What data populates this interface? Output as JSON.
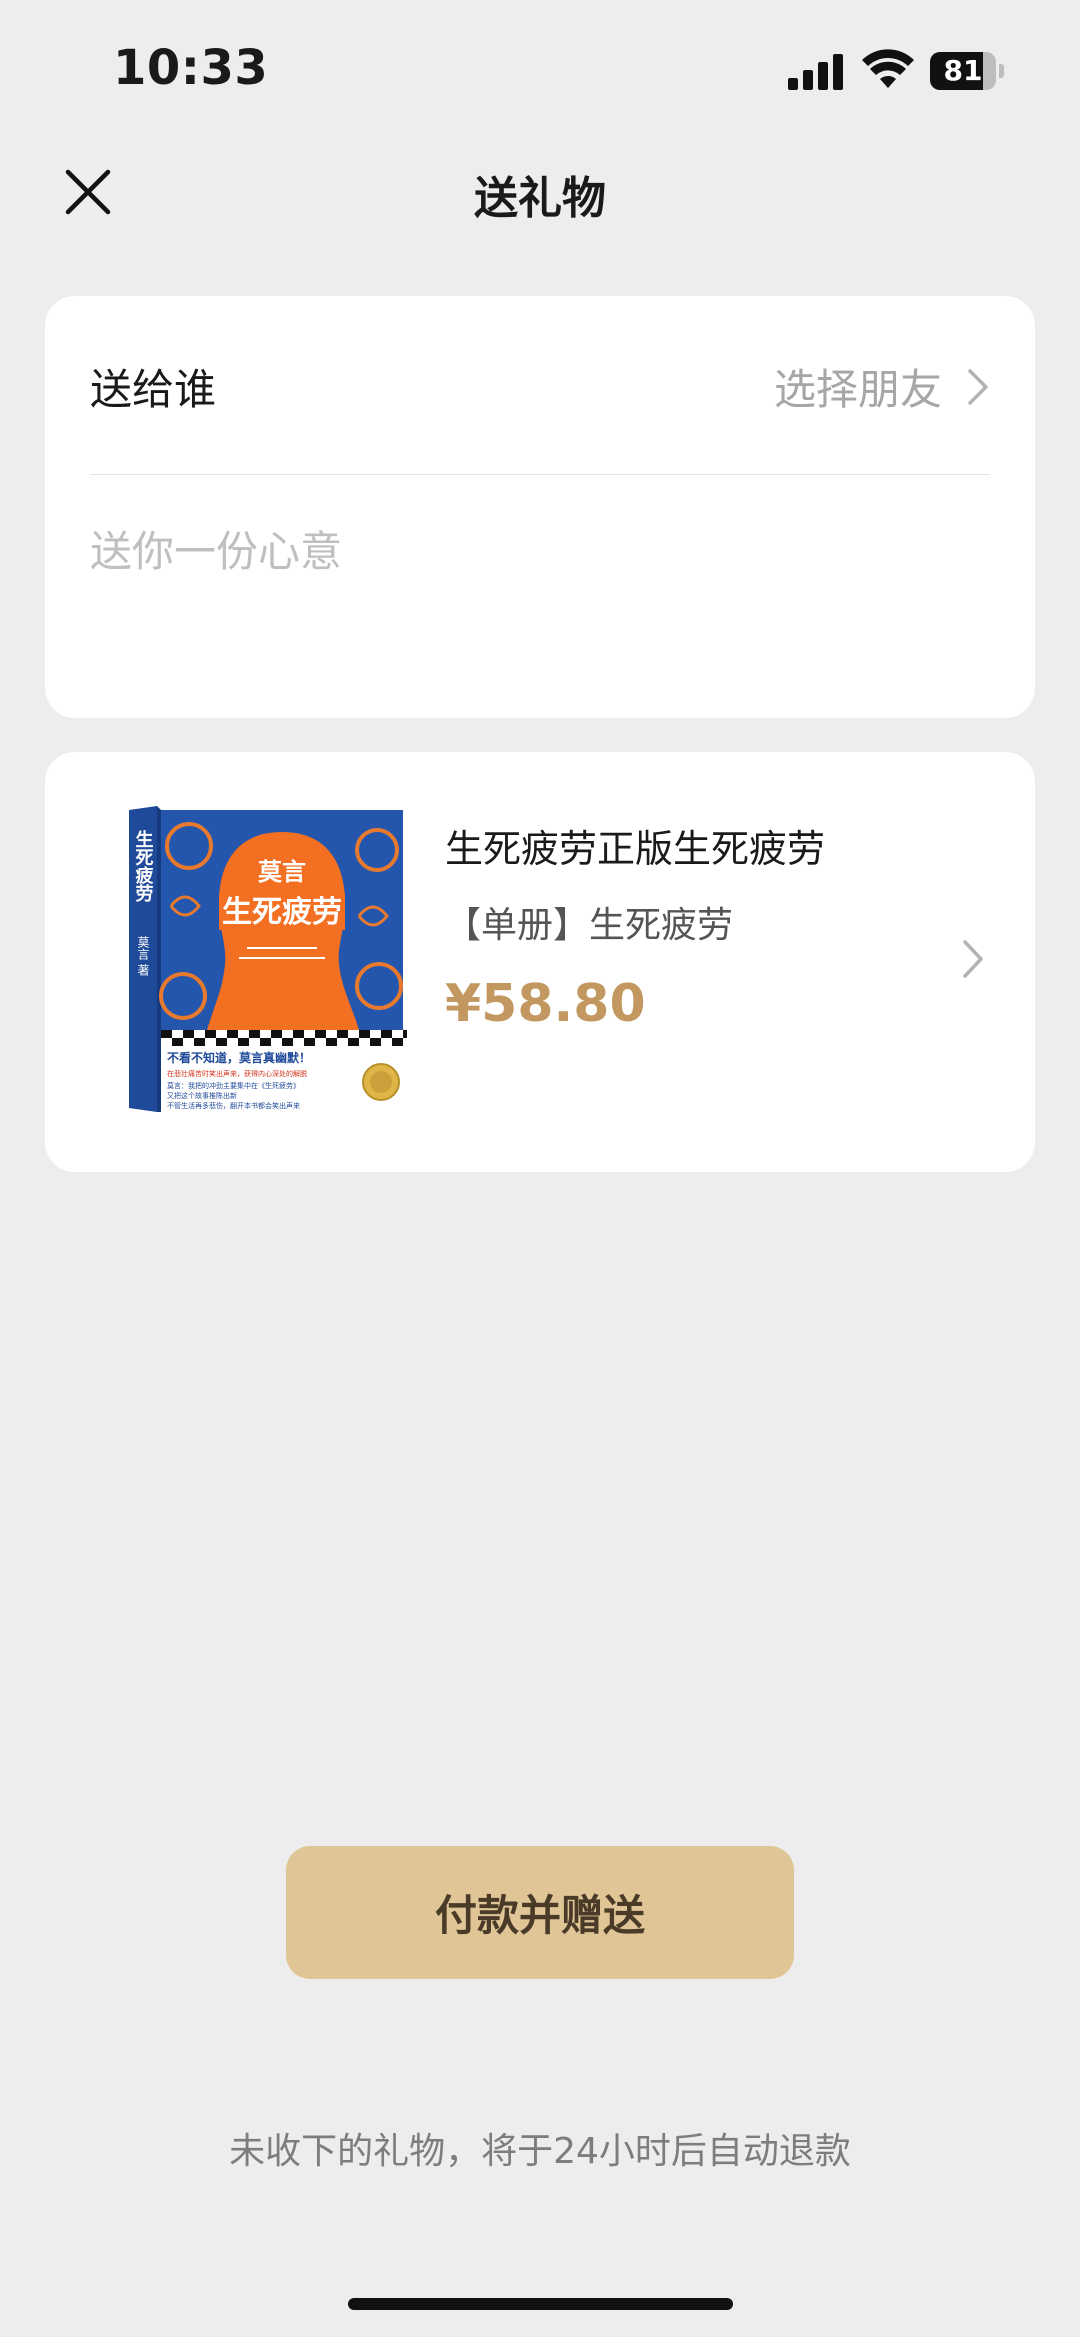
{
  "status_bar": {
    "time": "10:33",
    "battery": "81",
    "battery_level": 0.81
  },
  "nav": {
    "title": "送礼物",
    "close_icon": "close-icon"
  },
  "recipient": {
    "label": "送给谁",
    "choose_text": "选择朋友",
    "message_placeholder": "送你一份心意"
  },
  "product": {
    "name": "生死疲劳正版生死疲劳",
    "spec": "【单册】生死疲劳",
    "price": "¥58.80",
    "cover": {
      "author": "莫言",
      "title": "生死疲劳",
      "spine_title": "生死疲劳",
      "spine_author": "莫言 著",
      "slogan_1": "不看不知道，莫言真幽默！",
      "slogan_2": "在悲壮痛苦时笑出声来，获得内心深处的解脱",
      "slogan_3": "莫言：我把的冲劲主要集中在《生死疲劳》",
      "slogan_4": "又把这个故事推陈出新",
      "slogan_5": "不管生活再多悲伤，翻开本书都会笑出声来"
    }
  },
  "pay_button": "付款并赠送",
  "notice": "未收下的礼物，将于24小时后自动退款",
  "colors": {
    "accent": "#c29760",
    "button": "#e0c597",
    "background": "#ededed"
  }
}
